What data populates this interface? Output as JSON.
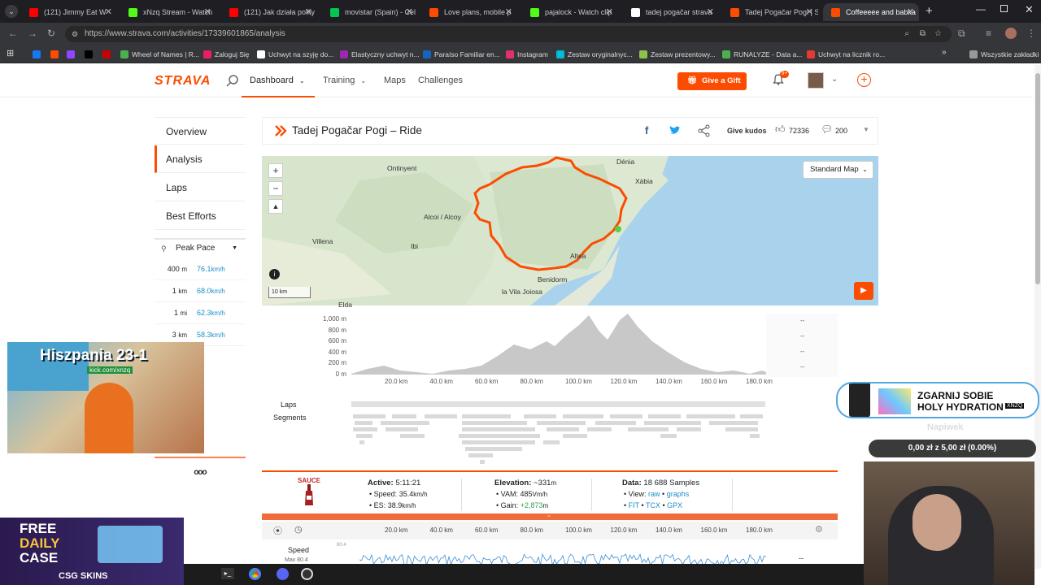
{
  "browser": {
    "tabs": [
      {
        "title": "(121) Jimmy Eat W",
        "color": "#ff0000"
      },
      {
        "title": "xNzq Stream - Watch",
        "color": "#53fc18"
      },
      {
        "title": "(121) Jak działa polity",
        "color": "#ff0000"
      },
      {
        "title": "movistar (Spain) - Cel",
        "color": "#00c853"
      },
      {
        "title": "Love plans, mobile p",
        "color": "#fc4c02"
      },
      {
        "title": "pajalock - Watch clip",
        "color": "#53fc18"
      },
      {
        "title": "tadej pogačar strava",
        "color": "#ffffff"
      },
      {
        "title": "Tadej Pogačar Pogi | S",
        "color": "#fc4c02"
      },
      {
        "title": "Coffeeeee and babka",
        "color": "#fc4c02"
      }
    ],
    "url": "https://www.strava.com/activities/17339601865/analysis",
    "bookmarks": [
      {
        "label": "",
        "color": "#1877f2"
      },
      {
        "label": "",
        "color": "#fc4c02"
      },
      {
        "label": "",
        "color": "#9146ff"
      },
      {
        "label": "",
        "color": "#000000"
      },
      {
        "label": "",
        "color": "#cc0000"
      },
      {
        "label": "Wheel of Names | R...",
        "color": "#4caf50"
      },
      {
        "label": "Zaloguj Się",
        "color": "#e91e63"
      },
      {
        "label": "Uchwyt na szyję do...",
        "color": "#ffffff"
      },
      {
        "label": "Elastyczny uchwyt n...",
        "color": "#9c27b0"
      },
      {
        "label": "Paraíso Familiar en...",
        "color": "#1565c0"
      },
      {
        "label": "Instagram",
        "color": "#e1306c"
      },
      {
        "label": "Zestaw oryginalnyc...",
        "color": "#00bcd4"
      },
      {
        "label": "Zestaw prezentowy...",
        "color": "#8bc34a"
      },
      {
        "label": "RUNALYZE - Data a...",
        "color": "#4caf50"
      },
      {
        "label": "Uchwyt na licznik ro...",
        "color": "#e53935"
      }
    ],
    "all_bookmarks": "Wszystkie zakładki"
  },
  "strava": {
    "logo": "STRAVA",
    "nav": [
      "Dashboard",
      "Training",
      "Maps",
      "Challenges"
    ],
    "gift_button": "Give a Gift",
    "notif_badge": "9+"
  },
  "sidebar": {
    "items": [
      "Overview",
      "Analysis",
      "Laps",
      "Best Efforts"
    ],
    "peak_pace_label": "Peak Pace",
    "peak_pace": [
      {
        "dist": "400",
        "unit": "m",
        "val": "76.1",
        "vunit": "km/h"
      },
      {
        "dist": "1",
        "unit": "km",
        "val": "68.0",
        "vunit": "km/h"
      },
      {
        "dist": "1",
        "unit": "mi",
        "val": "62.3",
        "vunit": "km/h"
      },
      {
        "dist": "3",
        "unit": "km",
        "val": "58.3",
        "vunit": "km/h"
      }
    ],
    "more": "ooo"
  },
  "activity": {
    "title": "Tadej Pogačar Pogi – Ride",
    "give_kudos": "Give kudos",
    "kudos_count": "72336",
    "comments_count": "200"
  },
  "map": {
    "style_select": "Standard Map",
    "scale": "10 km",
    "places": [
      "Ontinyent",
      "Dénia",
      "Xàbia",
      "Alcoi / Alcoy",
      "Villena",
      "Ibi",
      "Altea",
      "Benidorm",
      "la Vila Joiosa",
      "Elda"
    ]
  },
  "elevation": {
    "y_ticks": [
      "1,000 m",
      "800 m",
      "600 m",
      "400 m",
      "200 m",
      "0 m"
    ],
    "x_ticks": [
      "20.0 km",
      "40.0 km",
      "60.0 km",
      "80.0 km",
      "100.0 km",
      "120.0 km",
      "140.0 km",
      "160.0 km",
      "180.0 km"
    ],
    "side_values": [
      "--",
      "--",
      "--",
      "--"
    ],
    "laps_label": "Laps",
    "segments_label": "Segments"
  },
  "stats": {
    "brand": "SAUCE",
    "active_label": "Active:",
    "active_val": "5:11:21",
    "speed_label": "Speed:",
    "speed_val": "35.4",
    "speed_unit": "km/h",
    "es_label": "ES:",
    "es_val": "38.9",
    "es_unit": "km/h",
    "elev_label": "Elevation:",
    "elev_val": "~331",
    "elev_unit": "m",
    "vam_label": "VAM:",
    "vam_val": "485",
    "vam_unit": "Vm/h",
    "gain_label": "Gain:",
    "gain_val": "+2,873",
    "gain_unit": "m",
    "data_label": "Data:",
    "data_val": "18 688 Samples",
    "view_label": "View:",
    "view_raw": "raw",
    "view_graphs": "graphs",
    "fit": "FIT",
    "tcx": "TCX",
    "gpx": "GPX"
  },
  "speedchart": {
    "label": "Speed",
    "max": "Max 80.4",
    "y_top": "80.4",
    "side": "--"
  },
  "overlays": {
    "promo_title": "Hiszpania 23-1",
    "promo_sub": "kick.com/xnzq",
    "case_line1": "FREE",
    "case_line2": "DAILY",
    "case_line3": "CASE",
    "case_brand": "CSG SKINS",
    "ad_line1": "ZGARNIJ SOBIE",
    "ad_line2": "HOLY HYDRATION",
    "ad_code": "XNZQ",
    "tip_label": "Napiwek",
    "tip_bar": "0,00 zł z 5,00 zł (0.00%)"
  }
}
